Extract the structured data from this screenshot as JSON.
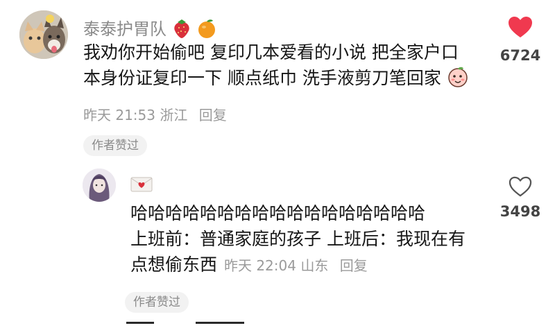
{
  "comments": [
    {
      "username": "泰泰护胃队",
      "username_badges": [
        "strawberry-icon",
        "orange-icon"
      ],
      "text_line1": "我劝你开始偷吧 复印几本爱看的小说 把全家户口",
      "text_line2": "本身份证复印一下 顺点纸巾 洗手液剪刀笔回家",
      "inline_emoji": "peach-face-emoji",
      "time": "昨天 21:53",
      "location": "浙江",
      "reply_label": "回复",
      "author_liked_tag": "作者赞过",
      "like_count": "6724",
      "liked": true,
      "like_color": "#f0394f"
    },
    {
      "username_badges": [
        "love-letter-icon"
      ],
      "text_line1": "哈哈哈哈哈哈哈哈哈哈哈哈哈哈哈哈哈",
      "text_line2": "上班前：普通家庭的孩子 上班后：我现在有",
      "text_line3": "点想偷东西",
      "time": "昨天 22:04",
      "location": "山东",
      "reply_label": "回复",
      "author_liked_tag": "作者赞过",
      "like_count": "3498",
      "liked": false
    }
  ]
}
